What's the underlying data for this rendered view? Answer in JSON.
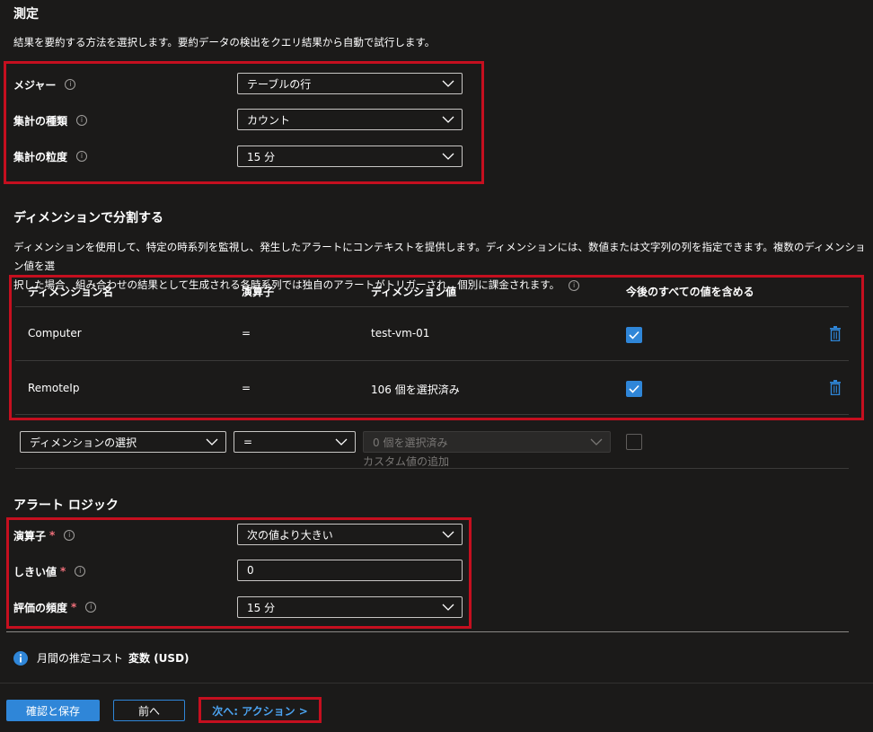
{
  "measurement": {
    "title": "測定",
    "description": "結果を要約する方法を選択します。要約データの検出をクエリ結果から自動で試行します。",
    "fields": [
      {
        "label": "メジャー",
        "value": "テーブルの行"
      },
      {
        "label": "集計の種類",
        "value": "カウント"
      },
      {
        "label": "集計の粒度",
        "value": "15 分"
      }
    ]
  },
  "split": {
    "title": "ディメンションで分割する",
    "description_line1": "ディメンションを使用して、特定の時系列を監視し、発生したアラートにコンテキストを提供します。ディメンションには、数値または文字列の列を指定できます。複数のディメンション値を選",
    "description_line2": "択した場合、組み合わせの結果として生成される各時系列では独自のアラートがトリガーされ、個別に課金されます。",
    "columns": [
      "ディメンション名",
      "演算子",
      "ディメンション値",
      "今後のすべての値を含める"
    ],
    "rows": [
      {
        "name": "Computer",
        "operator": "=",
        "value": "test-vm-01",
        "include_future": true
      },
      {
        "name": "RemoteIp",
        "operator": "=",
        "value": "106 個を選択済み",
        "include_future": true
      }
    ],
    "new_row": {
      "dimension_placeholder": "ディメンションの選択",
      "operator": "=",
      "values_placeholder": "0 個を選択済み",
      "add_custom": "カスタム値の追加"
    }
  },
  "alert_logic": {
    "title": "アラート ロジック",
    "operator_label": "演算子",
    "operator_value": "次の値より大きい",
    "threshold_label": "しきい値",
    "threshold_value": "0",
    "frequency_label": "評価の頻度",
    "frequency_value": "15 分",
    "required_mark": "*"
  },
  "cost": {
    "label": "月間の推定コスト",
    "value": "変数 (USD)"
  },
  "footer": {
    "review_button": "確認と保存",
    "prev_button": "前へ",
    "next_button": "次へ: アクション >"
  },
  "colors": {
    "accent": "#2f86d8",
    "highlight_box": "#c50f1f",
    "background": "#1b1a19"
  }
}
